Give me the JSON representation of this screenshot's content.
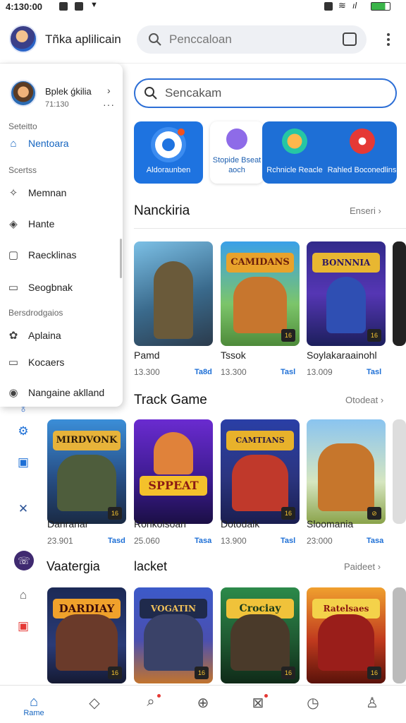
{
  "status_bar": {
    "time": "4:130:00"
  },
  "header": {
    "app_title": "Tñka aplilicain",
    "search_placeholder": "Penccaloan"
  },
  "drawer": {
    "user_name": "Bplek ǵkilia",
    "user_sub": "71:130",
    "sections": [
      {
        "label": "Seteitto"
      },
      {
        "label": "Scertss"
      },
      {
        "label": "Bersdrodgaios"
      }
    ],
    "items": [
      {
        "label": "Nentoara",
        "icon": "home-icon"
      },
      {
        "label": "Memnan",
        "icon": "gamepad-icon"
      },
      {
        "label": "Hante",
        "icon": "compass-icon"
      },
      {
        "label": "Raecklinas",
        "icon": "library-icon"
      },
      {
        "label": "Seogbnak",
        "icon": "bookmark-icon"
      },
      {
        "label": "Aplaina",
        "icon": "settings-icon"
      },
      {
        "label": "Kocaers",
        "icon": "file-icon"
      },
      {
        "label": "Nangaine aklland",
        "icon": "info-icon"
      }
    ]
  },
  "main_search": {
    "placeholder": "Sencakam"
  },
  "categories": [
    {
      "label": "Aldoraunben",
      "color": "#1e73e0"
    },
    {
      "label": "Stopide Bseat aoch",
      "color": "#ffffff"
    },
    {
      "label": "Rchnicle Reacle",
      "color": "#1e6fd6"
    },
    {
      "label": "Rahled Boconedlins",
      "color": "#1e6fd6"
    }
  ],
  "sections": [
    {
      "title": "Nanckiria",
      "more": "Enseri",
      "games": [
        {
          "name": "Pamd",
          "count": "13.300",
          "tag": "Ta8d",
          "banner": ""
        },
        {
          "name": "Tssok",
          "count": "13.300",
          "tag": "Tasl",
          "banner": "CAMIDANS"
        },
        {
          "name": "Soylakaraainohl",
          "count": "13.009",
          "tag": "Tasl",
          "banner": "BONNNIA"
        }
      ]
    },
    {
      "title": "Track Game",
      "more": "Otodeat",
      "games": [
        {
          "name": "Danranar",
          "count": "23.901",
          "tag": "Tasd",
          "banner": "MIRDVONK"
        },
        {
          "name": "Ronkolsoan",
          "count": "25.060",
          "tag": "Tasa",
          "banner": "SPPEAT"
        },
        {
          "name": "Dotodalk",
          "count": "13.900",
          "tag": "Tasl",
          "banner": "CAMTIANS"
        },
        {
          "name": "Sloomania",
          "count": "23:000",
          "tag": "Tasa",
          "banner": ""
        }
      ]
    },
    {
      "title": "lacket",
      "left_label": "Vaatergia",
      "more": "Paideet",
      "games": [
        {
          "name": "",
          "count": "",
          "tag": "",
          "banner": "DARDIAY"
        },
        {
          "name": "",
          "count": "",
          "tag": "",
          "banner": "VOGATIN"
        },
        {
          "name": "",
          "count": "",
          "tag": "",
          "banner": "Crociay"
        },
        {
          "name": "",
          "count": "",
          "tag": "",
          "banner": "Ratelsaes"
        }
      ]
    }
  ],
  "bottom_nav": [
    {
      "label": "Rame",
      "icon": "home-icon",
      "active": true
    },
    {
      "label": "",
      "icon": "diamond-icon"
    },
    {
      "label": "",
      "icon": "search-icon",
      "dot": true
    },
    {
      "label": "",
      "icon": "add-circle-icon"
    },
    {
      "label": "",
      "icon": "inbox-icon",
      "dot": true
    },
    {
      "label": "",
      "icon": "clock-icon"
    },
    {
      "label": "",
      "icon": "profile-icon"
    }
  ],
  "colors": {
    "accent": "#1565c0",
    "tile_blue": "#1e6fd6"
  }
}
